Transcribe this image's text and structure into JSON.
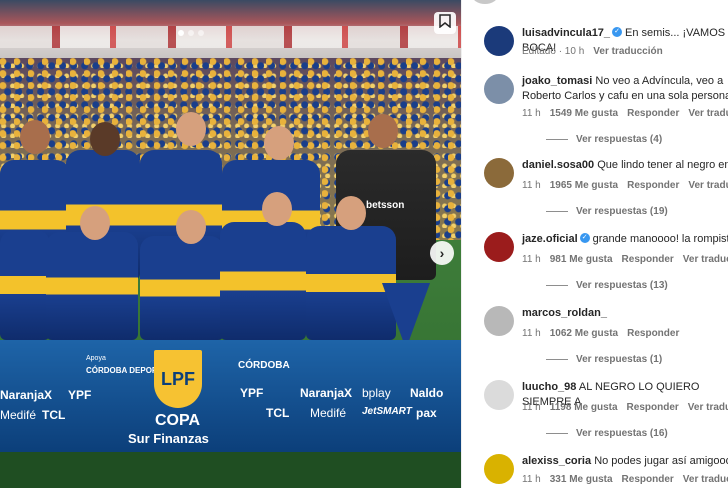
{
  "post": {
    "ads": {
      "apoya": "Apoya",
      "cordoba_deportes": "CÓRDOBA DEPORTES",
      "naranjax_left": "NaranjaX",
      "ypf_left": "YPF",
      "medife_left": "Medifé",
      "tcl_left": "TCL",
      "lpf": "LPF",
      "copa": "COPA",
      "sur_finanzas": "Sur Finanzas",
      "cordoba_right": "CÓRDOBA",
      "ypf_right": "YPF",
      "naranjax_right": "NaranjaX",
      "bplay": "bplay",
      "naldo": "Naldo",
      "tcl_right": "TCL",
      "medife_right": "Medifé",
      "jetsmart": "JetSMART",
      "pax": "pax",
      "betsson": "betsson"
    },
    "icons": {
      "save": "bookmark-icon",
      "next": "chevron-right-icon"
    }
  },
  "comments": [
    {
      "user": "luisadvincula17_",
      "verified": true,
      "text": "En semis... ¡VAMOS BOCA!",
      "meta": [
        "Editado · 10 h",
        "Ver traducción"
      ],
      "avatar_color": "#1b3a7a"
    },
    {
      "user": "joako_tomasi",
      "verified": false,
      "text": "No veo a Advíncula, veo a Roberto Carlos y cafu en una sola persona",
      "meta": [
        "11 h",
        "1549 Me gusta",
        "Responder",
        "Ver traducción"
      ],
      "replies": "Ver respuestas (4)",
      "avatar_color": "#7c8fa8"
    },
    {
      "user": "daniel.sosa00",
      "verified": false,
      "text": "Que lindo tener al negro en la",
      "meta": [
        "11 h",
        "1965 Me gusta",
        "Responder",
        "Ver traducción"
      ],
      "replies": "Ver respuestas (19)",
      "avatar_color": "#8b6a3a"
    },
    {
      "user": "jaze.oficial",
      "verified": true,
      "text": "grande manoooo! la rompiste",
      "meta": [
        "11 h",
        "981 Me gusta",
        "Responder",
        "Ver traducción"
      ],
      "replies": "Ver respuestas (13)",
      "avatar_color": "#9b1c1c"
    },
    {
      "user": "marcos_roldan_",
      "verified": false,
      "text": "",
      "meta": [
        "11 h",
        "1062 Me gusta",
        "Responder"
      ],
      "replies": "Ver respuestas (1)",
      "avatar_color": "#b8b8b8"
    },
    {
      "user": "luucho_98",
      "verified": false,
      "text": "AL NEGRO LO QUIERO SIEMPRE A",
      "meta": [
        "11 h",
        "1198 Me gusta",
        "Responder",
        "Ver traducción"
      ],
      "replies": "Ver respuestas (16)",
      "avatar_color": "#dbdbdb"
    },
    {
      "user": "alexiss_coria",
      "verified": false,
      "text": "No podes jugar así amigooo",
      "meta": [
        "11 h",
        "331 Me gusta",
        "Responder",
        "Ver traducción"
      ],
      "avatar_color": "#d9b200"
    }
  ]
}
